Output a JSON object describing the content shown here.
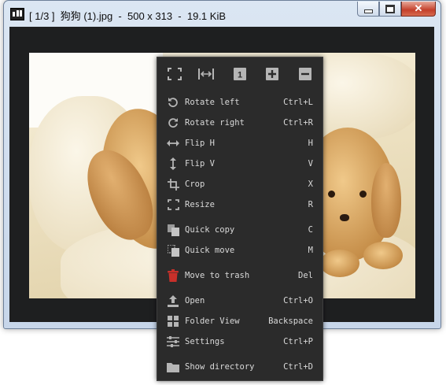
{
  "window": {
    "title": "[ 1/3 ]  狗狗 (1).jpg  -  500 x 313  -  19.1 KiB",
    "close_glyph": "✕"
  },
  "colors": {
    "menu_bg": "#2b2b2b",
    "menu_text": "#d9d9d9",
    "icon_gray": "#b5b5b5",
    "trash_red": "#c8302a",
    "viewer_bg": "#1e1f20"
  },
  "menu": {
    "toolbar": [
      {
        "name": "fit-window",
        "icon": "fit-window-icon"
      },
      {
        "name": "fit-width",
        "icon": "fit-width-icon"
      },
      {
        "name": "original-size",
        "icon": "original-size-icon",
        "glyph": "1"
      },
      {
        "name": "zoom-in",
        "icon": "zoom-in-icon",
        "glyph": "+"
      },
      {
        "name": "zoom-out",
        "icon": "zoom-out-icon",
        "glyph": "−"
      }
    ],
    "items": [
      {
        "label": "Rotate left",
        "shortcut": "Ctrl+L",
        "icon": "rotate-left-icon"
      },
      {
        "label": "Rotate right",
        "shortcut": "Ctrl+R",
        "icon": "rotate-right-icon"
      },
      {
        "label": "Flip H",
        "shortcut": "H",
        "icon": "flip-horizontal-icon"
      },
      {
        "label": "Flip V",
        "shortcut": "V",
        "icon": "flip-vertical-icon"
      },
      {
        "label": "Crop",
        "shortcut": "X",
        "icon": "crop-icon"
      },
      {
        "label": "Resize",
        "shortcut": "R",
        "icon": "resize-icon"
      },
      {
        "label": "Quick copy",
        "shortcut": "C",
        "icon": "copy-icon"
      },
      {
        "label": "Quick move",
        "shortcut": "M",
        "icon": "move-icon"
      },
      {
        "label": "Move to trash",
        "shortcut": "Del",
        "icon": "trash-icon"
      },
      {
        "label": "Open",
        "shortcut": "Ctrl+O",
        "icon": "open-icon"
      },
      {
        "label": "Folder View",
        "shortcut": "Backspace",
        "icon": "folder-view-icon"
      },
      {
        "label": "Settings",
        "shortcut": "Ctrl+P",
        "icon": "settings-icon"
      },
      {
        "label": "Show directory",
        "shortcut": "Ctrl+D",
        "icon": "folder-icon"
      }
    ]
  }
}
